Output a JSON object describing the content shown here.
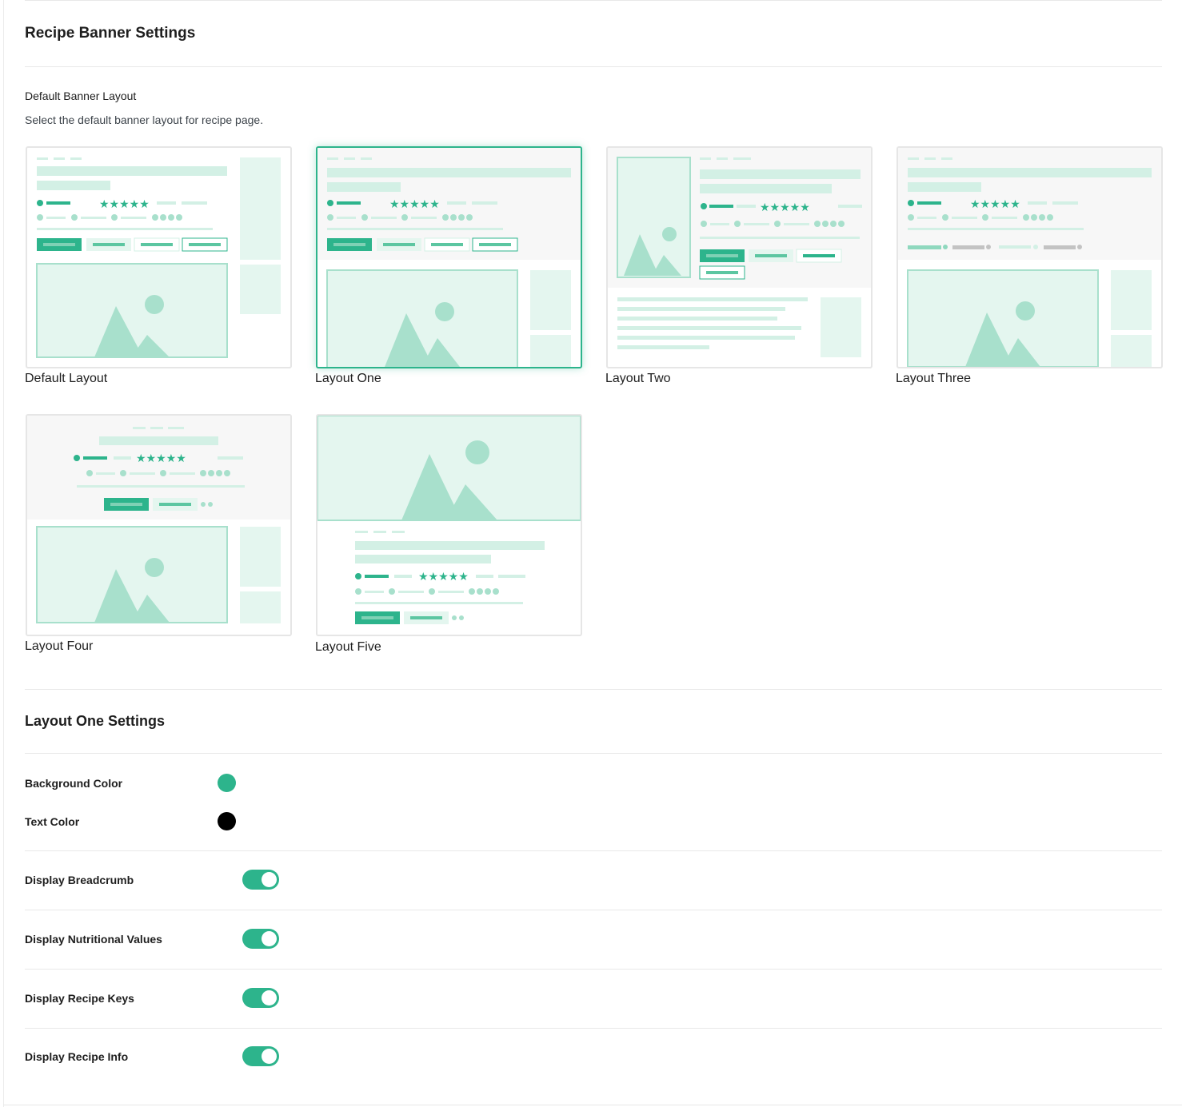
{
  "banner": {
    "title": "Recipe Banner Settings",
    "layout_label": "Default Banner Layout",
    "layout_desc": "Select the default banner layout for recipe page.",
    "layouts": [
      {
        "name": "Default Layout",
        "selected": false
      },
      {
        "name": "Layout One",
        "selected": true
      },
      {
        "name": "Layout Two",
        "selected": false
      },
      {
        "name": "Layout Three",
        "selected": false
      },
      {
        "name": "Layout Four",
        "selected": false
      },
      {
        "name": "Layout Five",
        "selected": false
      }
    ]
  },
  "layout_settings": {
    "title": "Layout One Settings",
    "bg_color_label": "Background Color",
    "bg_color": "#2db48c",
    "text_color_label": "Text Color",
    "text_color": "#000000",
    "toggles": [
      {
        "label": "Display Breadcrumb",
        "on": true
      },
      {
        "label": "Display Nutritional Values",
        "on": true
      },
      {
        "label": "Display Recipe Keys",
        "on": true
      },
      {
        "label": "Display Recipe Info",
        "on": true
      }
    ]
  },
  "colors": {
    "accent": "#2db48c",
    "light": "#d3f0e5",
    "lighter": "#e4f6ef",
    "mid": "#a8e0cc"
  }
}
